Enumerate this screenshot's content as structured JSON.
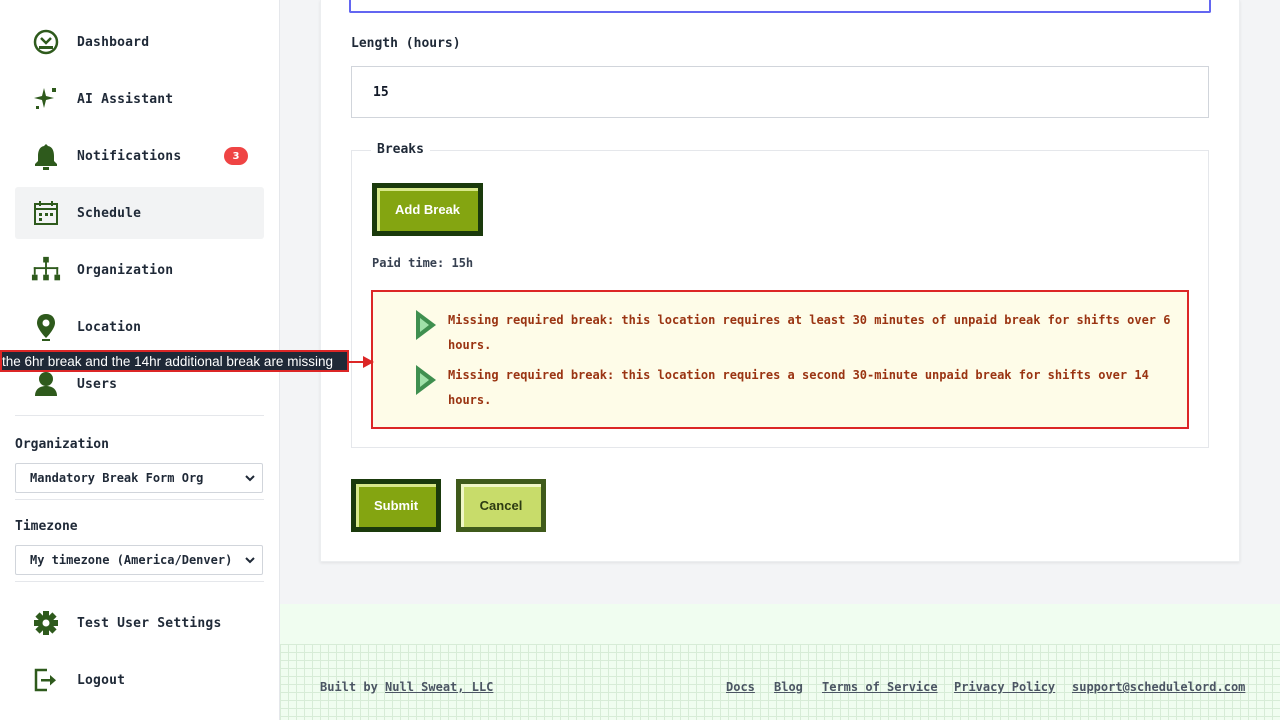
{
  "sidebar": {
    "nav": [
      {
        "label": "Dashboard",
        "icon": "dashboard-icon"
      },
      {
        "label": "AI Assistant",
        "icon": "sparkle-icon"
      },
      {
        "label": "Notifications",
        "icon": "bell-icon",
        "badge": "3"
      },
      {
        "label": "Schedule",
        "icon": "calendar-icon",
        "active": true
      },
      {
        "label": "Organization",
        "icon": "org-chart-icon"
      },
      {
        "label": "Location",
        "icon": "map-pin-icon"
      },
      {
        "label": "Users",
        "icon": "user-icon"
      }
    ],
    "organization": {
      "label": "Organization",
      "value": "Mandatory Break Form Org"
    },
    "timezone": {
      "label": "Timezone",
      "value": "My timezone (America/Denver)"
    },
    "bottom": [
      {
        "label": "Test User Settings",
        "icon": "gear-icon"
      },
      {
        "label": "Logout",
        "icon": "logout-icon"
      }
    ]
  },
  "form": {
    "length_label": "Length (hours)",
    "length_value": "15",
    "breaks_legend": "Breaks",
    "add_break_label": "Add Break",
    "paid_time": "Paid time: 15h",
    "alerts": [
      "Missing required break: this location requires at least 30 minutes of unpaid break for shifts over 6 hours.",
      "Missing required break: this location requires a second 30-minute unpaid break for shifts over 14 hours."
    ],
    "submit_label": "Submit",
    "cancel_label": "Cancel"
  },
  "annotation": {
    "text": "the 6hr break and the 14hr additional break are missing"
  },
  "footer": {
    "built_by_prefix": "Built by ",
    "built_by_link": "Null Sweat, LLC",
    "links": [
      "Docs",
      "Blog",
      "Terms of Service",
      "Privacy Policy",
      "support@schedulelord.com"
    ]
  },
  "colors": {
    "accent_green": "#84a511",
    "dark_green": "#1a3a0c",
    "icon_green": "#2e5a1c",
    "alert_border": "#dc2626",
    "alert_text": "#9a3412",
    "badge_red": "#ef4444",
    "focus_ring": "#6366f1"
  }
}
